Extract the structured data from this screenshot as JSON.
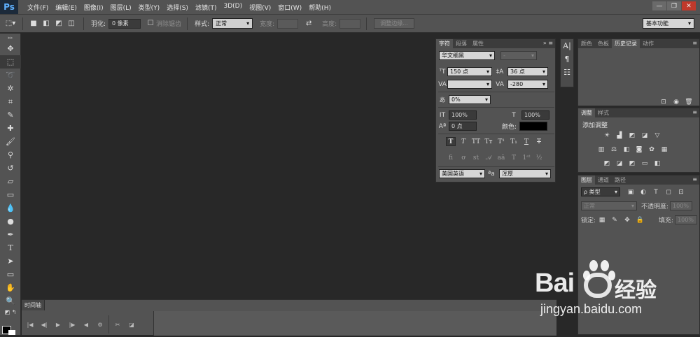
{
  "app": {
    "logo": "Ps"
  },
  "menu": [
    "文件(F)",
    "编辑(E)",
    "图像(I)",
    "图层(L)",
    "类型(Y)",
    "选择(S)",
    "滤镜(T)",
    "3D(D)",
    "视图(V)",
    "窗口(W)",
    "帮助(H)"
  ],
  "window_controls": {
    "minimize": "—",
    "restore": "❐",
    "close": "✕"
  },
  "options": {
    "feather_label": "羽化:",
    "feather_value": "0 像素",
    "antialias_label": "消除锯齿",
    "style_label": "样式:",
    "style_value": "正常",
    "width_label": "宽度:",
    "height_label": "高度:",
    "refine_button": "调整边缘...",
    "workspace": "基本功能"
  },
  "timeline": {
    "tab": "时间轴"
  },
  "char_panel": {
    "tabs": [
      "字符",
      "段落",
      "属性"
    ],
    "font_family": "华文细黑",
    "font_style": "-",
    "font_size": "150 点",
    "leading": "36 点",
    "kerning": "",
    "tracking": "-280",
    "tsume": "0%",
    "vscale": "100%",
    "hscale": "100%",
    "baseline": "0 点",
    "color_label": "颜色:",
    "color": "#000000",
    "language": "美国英语",
    "aa_icon": "ªa",
    "antialias": "浑厚"
  },
  "adjust_panel": {
    "tabs": [
      "调整",
      "样式"
    ],
    "title": "添加调整"
  },
  "history_panel": {
    "tabs": [
      "颜色",
      "色板",
      "历史记录",
      "动作"
    ]
  },
  "layers_panel": {
    "tabs": [
      "图层",
      "通道",
      "路径"
    ],
    "filter": "ρ 类型",
    "blend": "正常",
    "opacity_label": "不透明度:",
    "opacity": "100%",
    "lock_label": "锁定:",
    "fill_label": "填充:",
    "fill": "100%"
  },
  "watermark": {
    "brand_left": "Bai",
    "brand_right": "经验",
    "url": "jingyan.baidu.com"
  }
}
